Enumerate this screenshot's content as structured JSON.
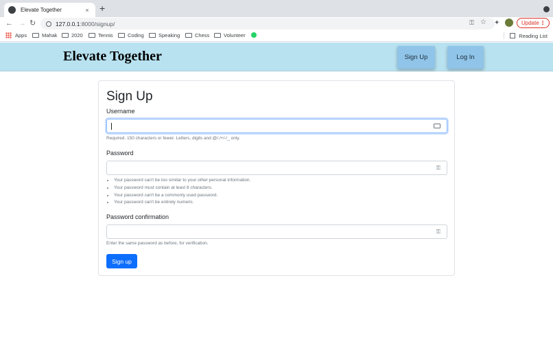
{
  "browser": {
    "tab_title": "Elevate Together",
    "tab_close": "×",
    "new_tab": "+",
    "url_host": "127.0.0.1",
    "url_path": ":8000/signup/",
    "back": "←",
    "forward": "→",
    "reload": "↻",
    "update_label": "Update",
    "update_menu": "⋮",
    "star": "☆",
    "key": "⚿",
    "extensions": "✦"
  },
  "bookmarks": {
    "items": [
      "Apps",
      "Mahak",
      "2020",
      "Tennis",
      "Coding",
      "Speaking",
      "Chess",
      "Volunteer"
    ],
    "reading_list": "Reading List"
  },
  "site": {
    "brand": "Elevate Together",
    "nav_signup": "Sign Up",
    "nav_login": "Log In"
  },
  "form": {
    "title": "Sign Up",
    "username_label": "Username",
    "username_value": "",
    "username_help": "Required. 150 characters or fewer. Letters, digits and @/./+/-/_ only.",
    "password_label": "Password",
    "password_value": "",
    "password_rules": [
      "Your password can't be too similar to your other personal information.",
      "Your password must contain at least 8 characters.",
      "Your password can't be a commonly used password.",
      "Your password can't be entirely numeric."
    ],
    "confirm_label": "Password confirmation",
    "confirm_value": "",
    "confirm_help": "Enter the same password as before, for verification.",
    "submit_label": "Sign up",
    "key_icon": "⚿"
  },
  "colors": {
    "header_bg": "#b8e2f0",
    "nav_button_bg": "#90c4e8",
    "primary": "#0d6efd"
  }
}
